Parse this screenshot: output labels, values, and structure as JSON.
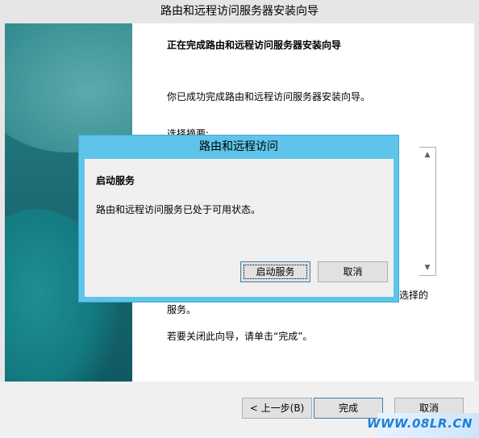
{
  "window": {
    "title": "路由和远程访问服务器安装向导"
  },
  "wizard": {
    "heading": "正在完成路由和远程访问服务器安装向导",
    "success_text": "你已成功完成路由和远程访问服务器安装向导。",
    "summary_label": "选择摘要:",
    "after_text_line1_suffix": "选择的",
    "after_text_line2": "服务。",
    "close_hint": "若要关闭此向导，请单击“完成”。",
    "back_button": "< 上一步(B)",
    "finish_button": "完成",
    "cancel_button": "取消"
  },
  "dialog": {
    "title": "路由和远程访问",
    "heading": "启动服务",
    "message": "路由和远程访问服务已处于可用状态。",
    "start_button": "启动服务",
    "cancel_button": "取消"
  },
  "watermark": {
    "text": "WWW.08LR.CN"
  },
  "icons": [
    "scroll-up-arrow-icon",
    "scroll-down-arrow-icon"
  ]
}
